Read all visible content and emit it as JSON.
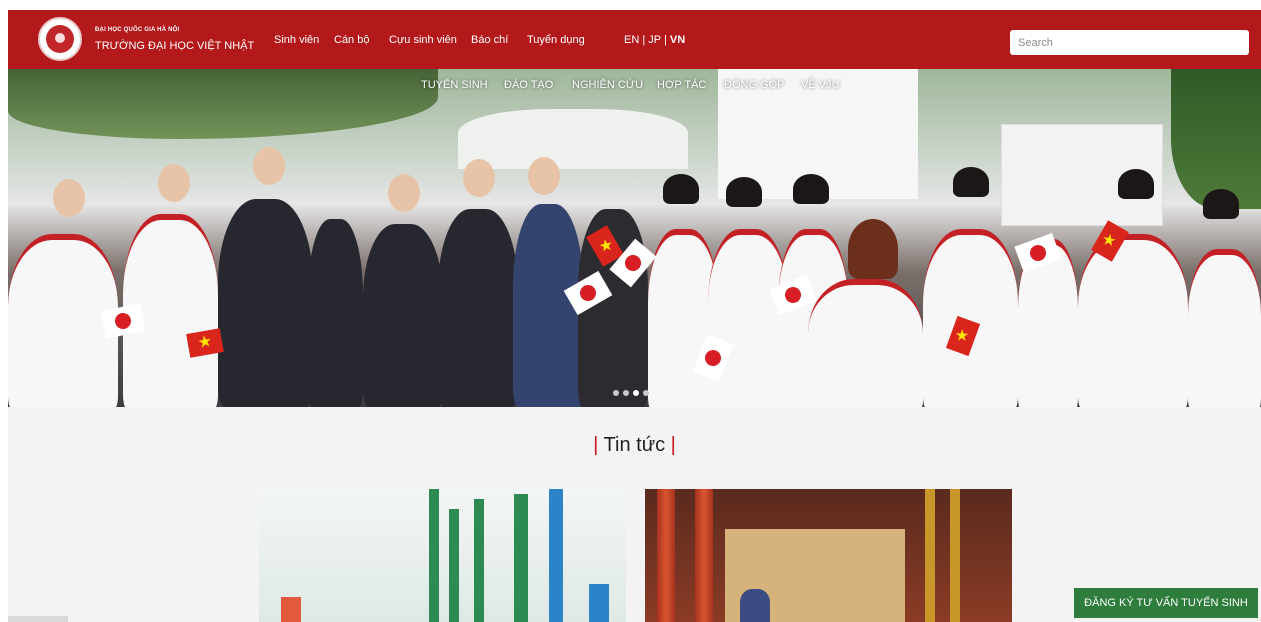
{
  "header": {
    "brand_small": "ĐẠI HỌC QUỐC GIA HÀ NỘI",
    "brand_big": "TRƯỜNG ĐẠI HỌC VIỆT NHẬT",
    "nav": [
      "Sinh viên",
      "Cán bộ",
      "Cựu sinh viên",
      "Báo chí",
      "Tuyển dụng"
    ],
    "languages": [
      "EN",
      "JP",
      "VN"
    ],
    "current_language": "VN",
    "search_placeholder": "Search"
  },
  "hero": {
    "menu": [
      "TUYỂN SINH",
      "ĐÀO TẠO",
      "NGHIÊN CỨU",
      "HỢP TÁC",
      "ĐÓNG GÓP",
      "VỀ VJU"
    ],
    "slide_count": 4,
    "active_slide": 3
  },
  "news": {
    "title": "Tin tức"
  },
  "cta": {
    "label": "ĐĂNG KÝ TƯ VẤN TUYỂN SINH"
  },
  "colors": {
    "header_red": "#b3191b",
    "accent_red": "#c8161d",
    "cta_green": "#2e7d3d"
  }
}
